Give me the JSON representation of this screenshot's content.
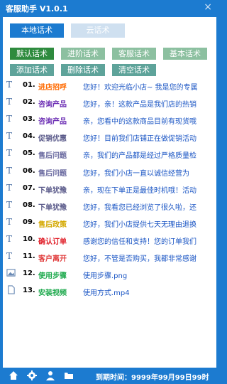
{
  "window": {
    "title": "客服助手 V1.0.1",
    "close_label": "×"
  },
  "modes": {
    "local": "本地话术",
    "cloud": "云话术"
  },
  "categories": {
    "default": "默认话术",
    "advanced": "进阶话术",
    "service": "客服话术",
    "basic": "基本话术",
    "add": "添加话术",
    "delete": "删除话术",
    "clear": "清空话术"
  },
  "items": [
    {
      "num": "01.",
      "tag": "进店招呼",
      "text": "您好！欢迎光临小店~ 我是您的专属",
      "tag_color": "#ff6a00",
      "icon": "text-icon"
    },
    {
      "num": "02.",
      "tag": "咨询产品",
      "text": "您好，亲！这款产品是我们店的热销",
      "tag_color": "#6a2bb3",
      "icon": "text-icon"
    },
    {
      "num": "03.",
      "tag": "咨询产品",
      "text": "亲，您看中的这款商品目前有现货哦",
      "tag_color": "#6a2bb3",
      "icon": "text-icon"
    },
    {
      "num": "04.",
      "tag": "促销优惠",
      "text": "您好！目前我们店铺正在做促销活动",
      "tag_color": "#5a5a8a",
      "icon": "text-icon"
    },
    {
      "num": "05.",
      "tag": "售后问题",
      "text": "亲，我们的产品都是经过严格质量检",
      "tag_color": "#6a6aa0",
      "icon": "text-icon"
    },
    {
      "num": "06.",
      "tag": "售后问题",
      "text": "您好，我们小店一直以诚信经营为",
      "tag_color": "#6a6aa0",
      "icon": "text-icon"
    },
    {
      "num": "07.",
      "tag": "下单犹豫",
      "text": "亲，现在下单正是最佳时机哦！活动",
      "tag_color": "#5a5a8a",
      "icon": "text-icon"
    },
    {
      "num": "08.",
      "tag": "下单犹豫",
      "text": "您好，我看您已经浏览了很久啦，还",
      "tag_color": "#5a5a8a",
      "icon": "text-icon"
    },
    {
      "num": "09.",
      "tag": "售后政策",
      "text": "您好，我们小店提供七天无理由退换",
      "tag_color": "#d4a800",
      "icon": "text-icon"
    },
    {
      "num": "10.",
      "tag": "确认订单",
      "text": "感谢您的信任和支持！您的订单我们",
      "tag_color": "#e0202a",
      "icon": "text-icon"
    },
    {
      "num": "11.",
      "tag": "客户离开",
      "text": "您好，不管是否购买，我都非常感谢",
      "tag_color": "#e03a3a",
      "icon": "text-icon"
    },
    {
      "num": "12.",
      "tag": "使用步骤",
      "text": "使用步骤.png",
      "tag_color": "#1aa84a",
      "icon": "image-icon"
    },
    {
      "num": "13.",
      "tag": "安装视频",
      "text": "使用方式.mp4",
      "tag_color": "#1aa84a",
      "icon": "file-icon"
    }
  ],
  "footer": {
    "expire_label": "到期时间：9999年99月99日99时"
  },
  "colors": {
    "primary": "#1c7bd0",
    "category_default": "#2e8b3e",
    "category_other": "#8cc0a0",
    "category_action": "#5ea39a"
  }
}
